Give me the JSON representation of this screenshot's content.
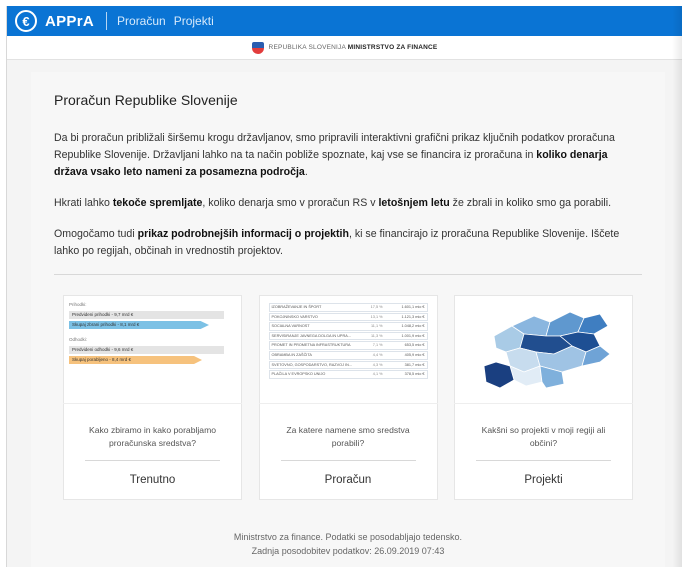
{
  "navbar": {
    "logo_glyph": "€",
    "brand": "APPrA",
    "links": [
      "Proračun",
      "Projekti"
    ],
    "color": "#0a74d4"
  },
  "gov_header": {
    "prefix": "REPUBLIKA SLOVENIJA",
    "ministry": "MINISTRSTVO ZA FINANCE"
  },
  "main": {
    "title": "Proračun Republike Slovenije",
    "p1": {
      "a": "Da bi proračun približali širšemu krogu državljanov, smo pripravili interaktivni grafični prikaz ključnih podatkov proračuna Republike Slovenije. Državljani lahko na ta način pobliže spoznate, kaj vse se financira iz proračuna in ",
      "b": "koliko denarja država vsako leto nameni za posamezna področja",
      "c": "."
    },
    "p2": {
      "a": "Hkrati lahko ",
      "b": "tekoče spremljate",
      "c": ", koliko denarja smo v proračun RS v ",
      "d": "letošnjem letu",
      "e": " že zbrali in koliko smo ga porabili."
    },
    "p3": {
      "a": "Omogočamo tudi ",
      "b": "prikaz podrobnejših informacij o projektih",
      "c": ", ki se financirajo iz proračuna Republike Slovenije. Iščete lahko po regijah, občinah in vrednostih projektov."
    }
  },
  "cards": [
    {
      "question": "Kako zbiramo in kako porabljamo proračunska sredstva?",
      "title": "Trenutno",
      "thumb": {
        "income_label": "Prihodki:",
        "income_planned": "Predvideni prihodki - 9,7 mrd €",
        "income_collected": "Skupaj zbrani prihodki - 8,1 mrd €",
        "expense_label": "Odhodki:",
        "expense_planned": "Predvideni odhodki - 9,6 mrd €",
        "expense_spent": "Skupaj porabljeno - 8,4 mrd €"
      }
    },
    {
      "question": "Za katere namene smo sredstva porabili?",
      "title": "Proračun",
      "thumb": {
        "rows": [
          {
            "name": "IZOBRAŽEVANJE IN ŠPORT",
            "pct": "17,5 %",
            "value": "1.601,1 mio €"
          },
          {
            "name": "POKOJNINSKO VARSTVO",
            "pct": "13,1 %",
            "value": "1.121,3 mio €"
          },
          {
            "name": "SOCIALNA VARNOST",
            "pct": "11,1 %",
            "value": "1.048,2 mio €"
          },
          {
            "name": "SERVISIRANJE JAVNEGA DOLGA IN UPRA...",
            "pct": "11,3 %",
            "value": "1.001,9 mio €"
          },
          {
            "name": "PROMET IN PROMETNA INFRASTRUKTURA",
            "pct": "7,1 %",
            "value": "653,5 mio €"
          },
          {
            "name": "OBRAMBA IN ZAŠČITA",
            "pct": "4,4 %",
            "value": "405,9 mio €"
          },
          {
            "name": "SVETOVNO, GOSPODARSTVO, RAZVOJ IN...",
            "pct": "4,3 %",
            "value": "381,7 mio €"
          },
          {
            "name": "PLAČILA V EVROPSKO UNIJO",
            "pct": "4,1 %",
            "value": "378,5 mio €"
          }
        ]
      }
    },
    {
      "question": "Kakšni so projekti v moji regiji ali občini?",
      "title": "Projekti"
    }
  ],
  "footer": {
    "line1": "Ministrstvo za finance. Podatki se posodabljajo tedensko.",
    "line2": "Zadnja posodobitev podatkov: 26.09.2019 07:43"
  }
}
